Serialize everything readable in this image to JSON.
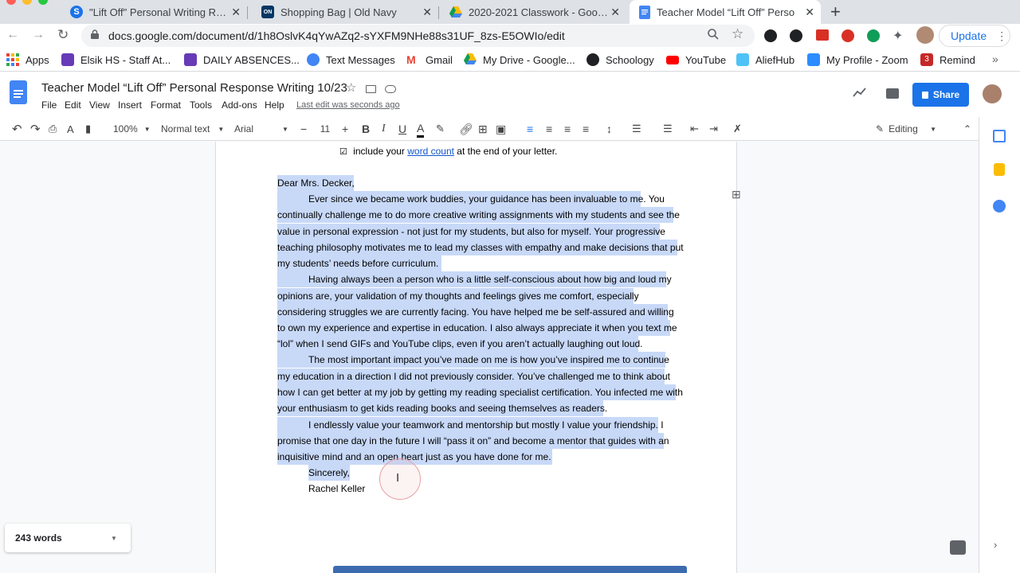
{
  "tabs": [
    {
      "title": "\"Lift Off\" Personal Writing Resp",
      "favicon": "S",
      "color": "#1a73e8"
    },
    {
      "title": "Shopping Bag | Old Navy",
      "favicon": "ON",
      "color": "#003764"
    },
    {
      "title": "2020-2021 Classwork - Google",
      "favicon": "drive-icon",
      "color": "#fbbc04"
    },
    {
      "title": "Teacher Model “Lift Off” Perso",
      "favicon": "docs-icon",
      "color": "#4285f4"
    }
  ],
  "address": {
    "url": "docs.google.com/document/d/1h8OslvK4qYwAZq2-sYXFM9NHe88s31UF_8zs-E5OWIo/edit",
    "update_label": "Update"
  },
  "bookmarks": [
    {
      "label": "Apps",
      "color": "#ea4335"
    },
    {
      "label": "Elsik HS - Staff At...",
      "color": "#673ab7"
    },
    {
      "label": "DAILY ABSENCES...",
      "color": "#673ab7"
    },
    {
      "label": "Text Messages",
      "color": "#4285f4"
    },
    {
      "label": "Gmail",
      "color": "#ea4335"
    },
    {
      "label": "My Drive - Google...",
      "color": "#fbbc04"
    },
    {
      "label": "Schoology",
      "color": "#202124"
    },
    {
      "label": "YouTube",
      "color": "#ff0000"
    },
    {
      "label": "AliefHub",
      "color": "#4fc3f7"
    },
    {
      "label": "My Profile - Zoom",
      "color": "#2d8cff"
    },
    {
      "label": "Remind",
      "color": "#c62828",
      "badge": "3"
    }
  ],
  "doc": {
    "title": "Teacher Model “Lift Off” Personal Response Writing 10/23",
    "menus": [
      "File",
      "Edit",
      "View",
      "Insert",
      "Format",
      "Tools",
      "Add-ons",
      "Help"
    ],
    "last_edit": "Last edit was seconds ago",
    "share_label": "Share"
  },
  "toolbar": {
    "zoom": "100%",
    "style": "Normal text",
    "font": "Arial",
    "font_size": "11",
    "mode": "Editing"
  },
  "content": {
    "checklist_prefix": "include your ",
    "checklist_link": "word count",
    "checklist_suffix": " at the end of your letter.",
    "lines": [
      "Dear Mrs. Decker,",
      "Ever since we became work buddies, your guidance has been invaluable to me. You",
      "continually challenge me to do more creative writing assignments with my students and see the",
      "value in personal expression - not just for my students, but also for myself. Your progressive",
      "teaching philosophy motivates me to lead my classes with empathy and make decisions that put",
      "my students’ needs before curriculum.",
      "Having always been a person who is a little self-conscious about how big and loud my",
      "opinions are, your validation of my thoughts and feelings gives me comfort, especially",
      "considering struggles we are currently facing. You have helped me be self-assured and willing",
      "to own my experience and expertise in education. I also always appreciate it when you text me",
      "“lol” when I send GIFs and YouTube clips, even if you aren’t actually laughing out loud.",
      "The most important impact you’ve made on me is how you’ve inspired me to continue",
      "my education in a direction I did not previously consider. You’ve challenged me to think about",
      "how I can get better at my job by getting my reading specialist certification. You infected me with",
      "your enthusiasm to get kids reading books and seeing themselves as readers.",
      "I endlessly value your teamwork and mentorship but mostly I value your friendship. I",
      "promise that one day in the future I will “pass it on” and become a mentor that guides with an",
      "inquisitive mind and an open heart just as you have done for me.",
      "Sincerely,",
      "Rachel Keller"
    ]
  },
  "word_count": {
    "label": "243 words"
  }
}
